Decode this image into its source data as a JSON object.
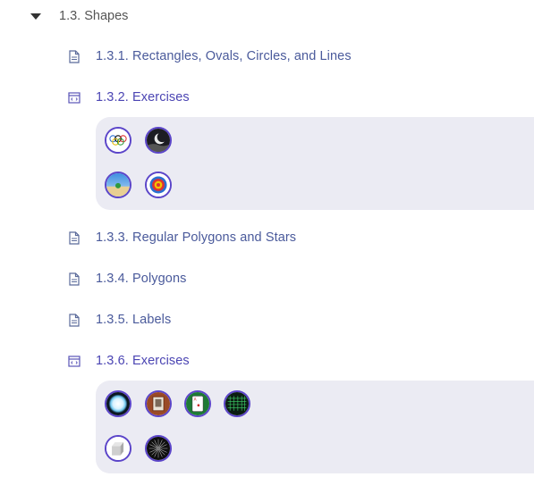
{
  "section": {
    "title": "1.3. Shapes",
    "caret_icon": "caret-down-icon"
  },
  "items": [
    {
      "label": "1.3.1. Rectangles, Ovals, Circles, and Lines",
      "icon": "document-icon",
      "kind": "page"
    },
    {
      "label": "1.3.2. Exercises",
      "icon": "exercise-window-icon",
      "kind": "exercise"
    },
    {
      "label": "1.3.3. Regular Polygons and Stars",
      "icon": "document-icon",
      "kind": "page"
    },
    {
      "label": "1.3.4. Polygons",
      "icon": "document-icon",
      "kind": "page"
    },
    {
      "label": "1.3.5. Labels",
      "icon": "document-icon",
      "kind": "page"
    },
    {
      "label": "1.3.6. Exercises",
      "icon": "exercise-window-icon",
      "kind": "exercise"
    }
  ],
  "exercises_1": {
    "thumbnails": [
      {
        "name": "olympic-rings-thumbnail"
      },
      {
        "name": "night-moon-thumbnail"
      },
      {
        "name": "desert-sun-thumbnail"
      },
      {
        "name": "archery-target-thumbnail"
      }
    ]
  },
  "exercises_2": {
    "thumbnails": [
      {
        "name": "glowing-orb-thumbnail"
      },
      {
        "name": "framed-picture-thumbnail"
      },
      {
        "name": "playing-card-thumbnail"
      },
      {
        "name": "green-grid-thumbnail"
      },
      {
        "name": "gray-cube-thumbnail"
      },
      {
        "name": "spoked-wheel-thumbnail"
      }
    ]
  },
  "colors": {
    "link": "#4a5a9b",
    "exercise_link": "#4b45b3",
    "thumb_border": "#5b45c9",
    "panel_bg": "#ebebf3",
    "header_text": "#555555"
  }
}
